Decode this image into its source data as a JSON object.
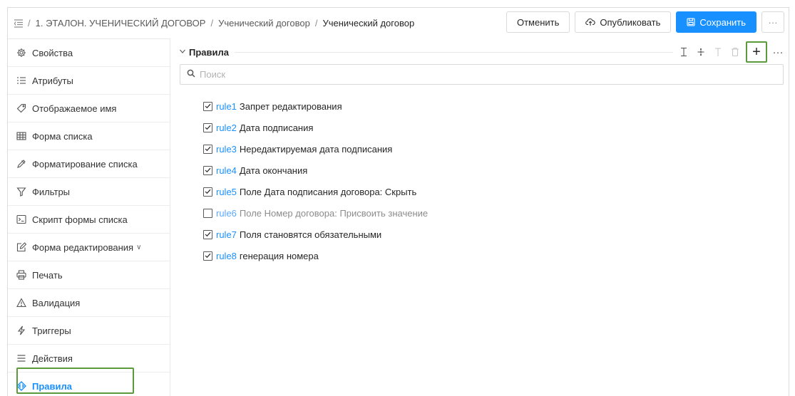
{
  "header": {
    "breadcrumb": [
      "1. ЭТАЛОН. УЧЕНИЧЕСКИЙ ДОГОВОР",
      "Ученический договор",
      "Ученический договор"
    ],
    "separator": "/",
    "buttons": {
      "cancel": "Отменить",
      "publish": "Опубликовать",
      "save": "Сохранить",
      "more": "···"
    }
  },
  "sidebar": {
    "items": [
      {
        "label": "Свойства",
        "icon": "gear-icon"
      },
      {
        "label": "Атрибуты",
        "icon": "list-icon"
      },
      {
        "label": "Отображаемое имя",
        "icon": "tag-icon"
      },
      {
        "label": "Форма списка",
        "icon": "table-icon"
      },
      {
        "label": "Форматирование списка",
        "icon": "brush-icon"
      },
      {
        "label": "Фильтры",
        "icon": "filter-icon"
      },
      {
        "label": "Скрипт формы списка",
        "icon": "terminal-icon"
      },
      {
        "label": "Форма редактирования",
        "icon": "edit-icon",
        "chevron": "∨"
      },
      {
        "label": "Печать",
        "icon": "printer-icon"
      },
      {
        "label": "Валидация",
        "icon": "warning-icon"
      },
      {
        "label": "Триггеры",
        "icon": "lightning-icon"
      },
      {
        "label": "Действия",
        "icon": "menu-icon"
      },
      {
        "label": "Правила",
        "icon": "rules-icon",
        "active": true
      }
    ]
  },
  "section": {
    "title": "Правила",
    "tools": {
      "more": "···",
      "add": "+"
    }
  },
  "search": {
    "placeholder": "Поиск",
    "value": ""
  },
  "rules": [
    {
      "id": "rule1",
      "name": "Запрет редактирования",
      "checked": true
    },
    {
      "id": "rule2",
      "name": "Дата подписания",
      "checked": true
    },
    {
      "id": "rule3",
      "name": "Нередактируемая дата подписания",
      "checked": true
    },
    {
      "id": "rule4",
      "name": "Дата окончания",
      "checked": true
    },
    {
      "id": "rule5",
      "name": "Поле Дата подписания договора: Скрыть",
      "checked": true
    },
    {
      "id": "rule6",
      "name": "Поле Номер договора: Присвоить значение",
      "checked": false
    },
    {
      "id": "rule7",
      "name": "Поля становятся обязательными",
      "checked": true
    },
    {
      "id": "rule8",
      "name": "генерация номера",
      "checked": true
    }
  ],
  "colors": {
    "accent": "#1890ff",
    "highlight": "#5b9a3d"
  }
}
